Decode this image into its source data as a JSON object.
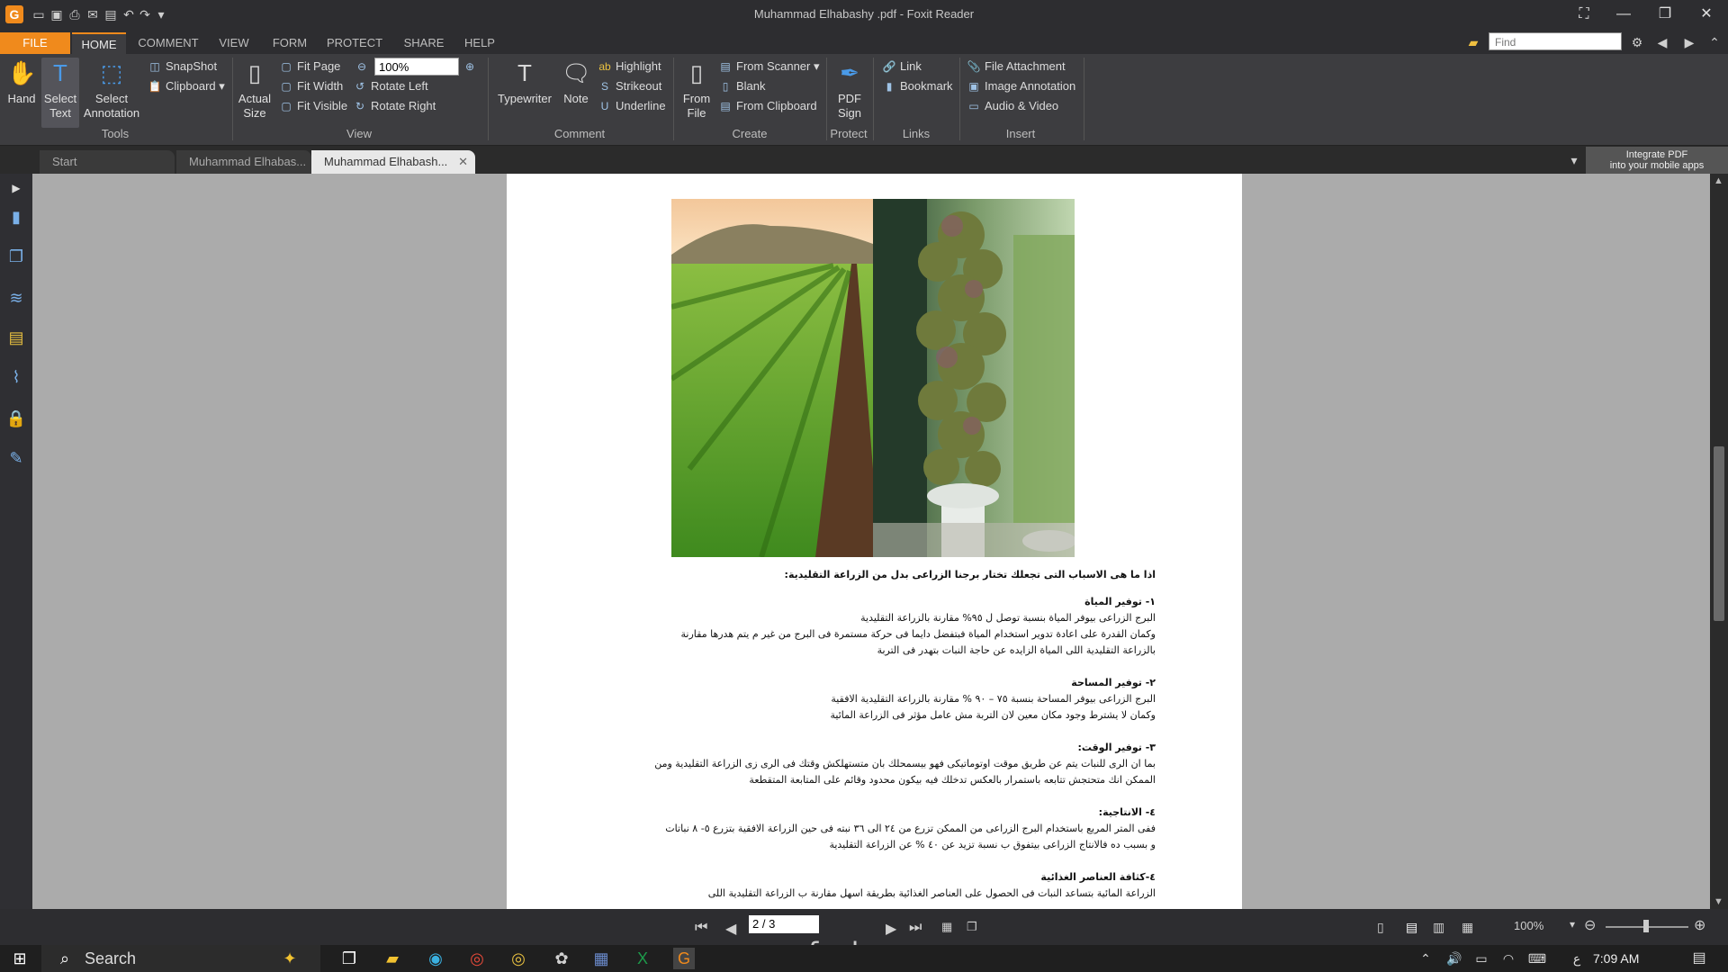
{
  "window": {
    "title": "Muhammad Elhabashy .pdf - Foxit Reader",
    "app_icon": "G"
  },
  "menu": {
    "tabs": [
      "FILE",
      "HOME",
      "COMMENT",
      "VIEW",
      "FORM",
      "PROTECT",
      "SHARE",
      "HELP"
    ],
    "active": "HOME",
    "find_placeholder": "Find"
  },
  "ribbon": {
    "tools": {
      "hand": "Hand",
      "select_text": [
        "Select",
        "Text"
      ],
      "select_annotation": [
        "Select",
        "Annotation"
      ],
      "snapshot": "SnapShot",
      "clipboard": "Clipboard",
      "label": "Tools"
    },
    "view": {
      "actual_size": [
        "Actual",
        "Size"
      ],
      "fit_page": "Fit Page",
      "fit_width": "Fit Width",
      "fit_visible": "Fit Visible",
      "zoom_value": "100%",
      "rotate_left": "Rotate Left",
      "rotate_right": "Rotate Right",
      "label": "View"
    },
    "comment": {
      "typewriter": "Typewriter",
      "note": "Note",
      "highlight": "Highlight",
      "strikeout": "Strikeout",
      "underline": "Underline",
      "label": "Comment"
    },
    "create": {
      "from_file": [
        "From",
        "File"
      ],
      "from_scanner": "From Scanner",
      "blank": "Blank",
      "from_clipboard": "From Clipboard",
      "label": "Create"
    },
    "protect": {
      "pdf_sign": [
        "PDF",
        "Sign"
      ],
      "label": "Protect"
    },
    "links": {
      "link": "Link",
      "bookmark": "Bookmark",
      "label": "Links"
    },
    "insert": {
      "file_attachment": "File Attachment",
      "image_annotation": "Image Annotation",
      "audio_video": "Audio & Video",
      "label": "Insert"
    }
  },
  "doc_tabs": [
    "Start",
    "Muhammad Elhabas...",
    "Muhammad Elhabash..."
  ],
  "promo": [
    "Integrate PDF",
    "into your mobile apps"
  ],
  "document": {
    "lines": [
      {
        "text": "اذا ما هى الاسباب التى تجعلك تختار برجنا الزراعى بدل من الزراعة التقليدية:",
        "h": true
      },
      {
        "text": "١- توفير المياة",
        "h": true
      },
      {
        "text": "البرج الزراعى بيوفر المياة بنسبة توصل ل ٩٥% مقارنة بالزراعة التقليدية",
        "h": false
      },
      {
        "text": "وكمان القدرة على اعادة تدوير استخدام المياة فبتفضل دايما فى حركة مستمرة فى البرج من غير م يتم هدرها مقارنة",
        "h": false
      },
      {
        "text": "بالزراعة التقليدية اللى المياة الزايده عن حاجة النبات بتهدر فى التربة",
        "h": false
      },
      {
        "text": "٢- توفير المساحة",
        "h": true
      },
      {
        "text": "البرج الزراعى بيوفر المساحة بنسبة ٧٥ – ٩٠ % مقارنة بالزراعة التقليدية الافقية",
        "h": false
      },
      {
        "text": "وكمان لا يشترط وجود مكان معين لان التربة مش عامل مؤثر فى الزراعة المائية",
        "h": false
      },
      {
        "text": "٣- توفير الوقت:",
        "h": true
      },
      {
        "text": "بما ان الرى للنبات يتم عن طريق موقت اوتوماتيكى فهو بيسمحلك بان متستهلكش وقتك فى الرى زى الزراعة التقليدية ومن",
        "h": false
      },
      {
        "text": "الممكن انك متحتجش تتابعه باستمرار بالعكس تدخلك فيه بيكون محدود وقائم على المتابعة المتقطعة",
        "h": false
      },
      {
        "text": "٤- الانتاجية:",
        "h": true
      },
      {
        "text": "ففى المتر المربع باستخدام البرج الزراعى من الممكن تزرع من ٢٤ الى ٣٦ نبته فى حين الزراعة الافقية بتزرع ٥- ٨ نباتات",
        "h": false
      },
      {
        "text": "و بسبب ده  فالانتاج الزراعى بيتفوق ب نسبة تزيد عن ٤٠ % عن الزراعة التقليدية",
        "h": false
      },
      {
        "text": "٤-كثافة العناصر الغذائية",
        "h": true
      },
      {
        "text": "الزراعة المائية بتساعد النبات فى الحصول على العناصر الغذائية بطريقة اسهل مقارنة ب الزراعة التقليدية اللى",
        "h": false
      }
    ]
  },
  "status": {
    "page_indicator": "2 / 3",
    "zoom": "100%"
  },
  "watermark": "nafezly.com",
  "taskbar": {
    "search_placeholder": "Search",
    "language": "ع",
    "time": "7:09 AM"
  },
  "colors": {
    "accent": "#f08a1c",
    "ribbon_bg": "#3d3d40",
    "doc_bg": "#ababab"
  }
}
